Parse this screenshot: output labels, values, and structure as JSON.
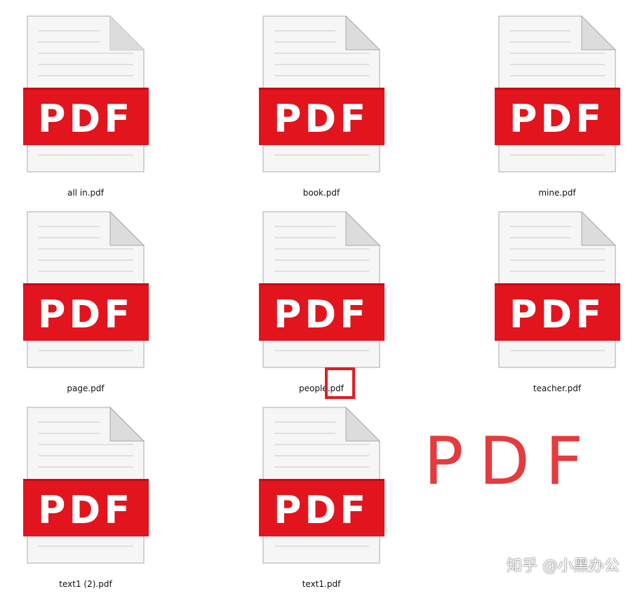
{
  "files": [
    {
      "name": "all in.pdf",
      "icon": "pdf-file-icon",
      "badge": "PDF"
    },
    {
      "name": "book.pdf",
      "icon": "pdf-file-icon",
      "badge": "PDF"
    },
    {
      "name": "mine.pdf",
      "icon": "pdf-file-icon",
      "badge": "PDF"
    },
    {
      "name": "page.pdf",
      "icon": "pdf-file-icon",
      "badge": "PDF"
    },
    {
      "name": "people.pdf",
      "icon": "pdf-file-icon",
      "badge": "PDF"
    },
    {
      "name": "teacher.pdf",
      "icon": "pdf-file-icon",
      "badge": "PDF"
    },
    {
      "name": "text1 (2).pdf",
      "icon": "pdf-file-icon",
      "badge": "PDF"
    },
    {
      "name": "text1.pdf",
      "icon": "pdf-file-icon",
      "badge": "PDF"
    }
  ],
  "annotation": {
    "big_label": "PDF",
    "color": "#e31b23"
  },
  "watermark": "知乎 @小黑办公",
  "colors": {
    "badge_red": "#e2141d",
    "page_bg": "#ffffff",
    "file_border": "#a9a9a9"
  }
}
